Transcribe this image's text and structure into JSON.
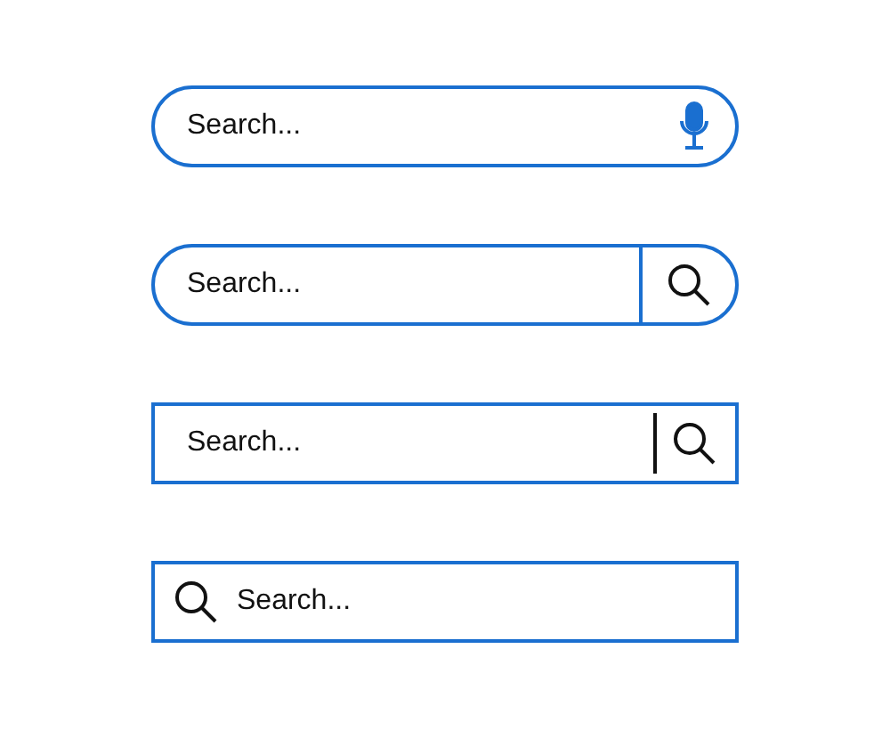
{
  "search_bars": [
    {
      "kind": "mic-pill",
      "placeholder": "Search..."
    },
    {
      "kind": "button-pill",
      "placeholder": "Search..."
    },
    {
      "kind": "button-rect",
      "placeholder": "Search..."
    },
    {
      "kind": "icon-left-rect",
      "placeholder": "Search..."
    }
  ]
}
